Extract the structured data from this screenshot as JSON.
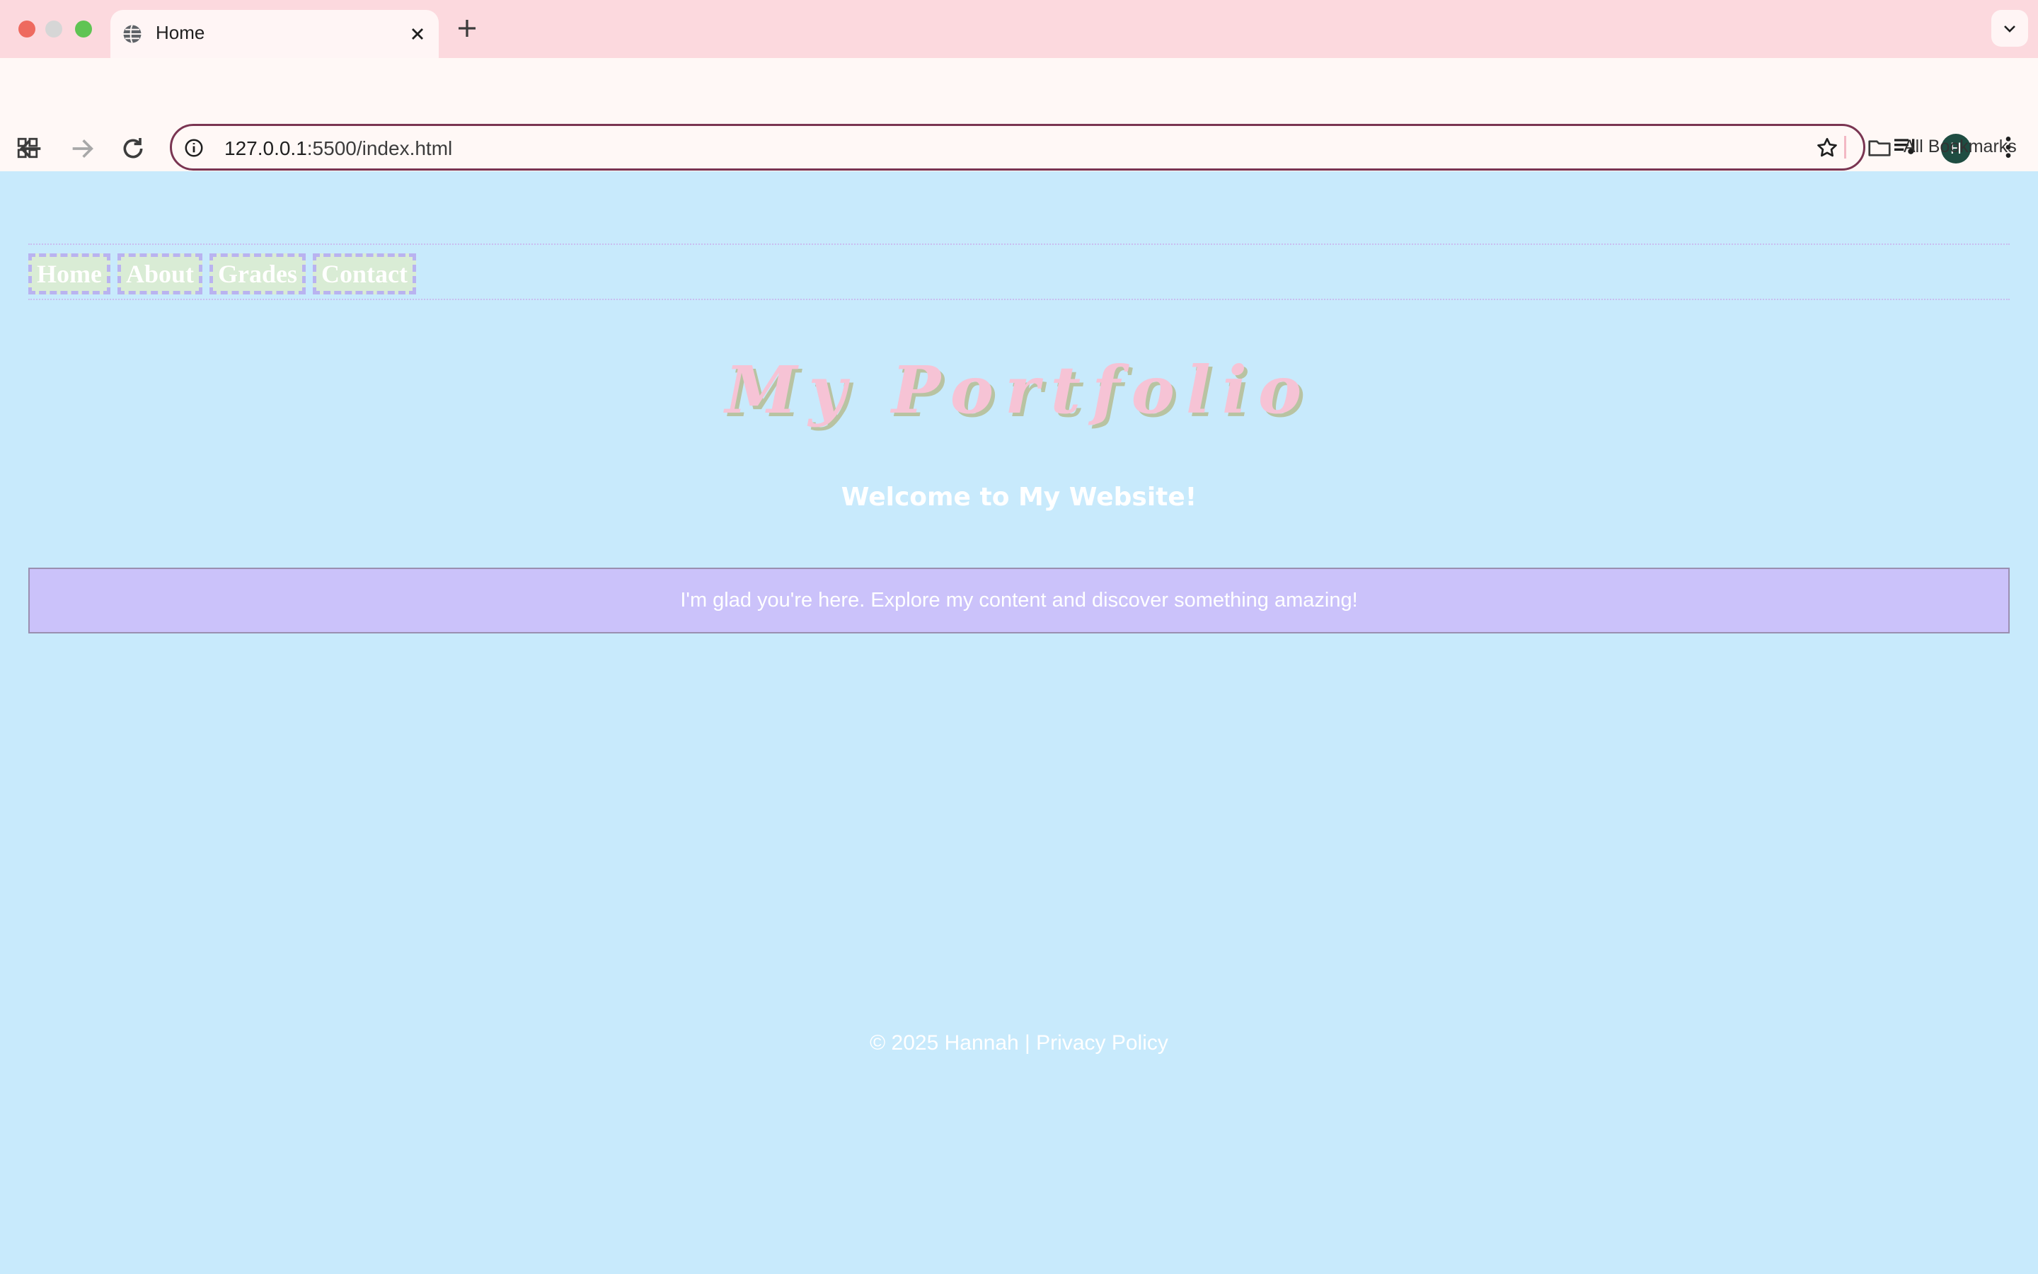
{
  "browser": {
    "tab": {
      "title": "Home"
    },
    "address_bar": {
      "url_host": "127.0.0.1",
      "url_rest": ":5500/index.html"
    },
    "profile_initial": "H",
    "bookmarks": {
      "all_bookmarks_label": "All Bookmarks"
    },
    "colors": {
      "tab_strip": "#fcd9de",
      "toolbar": "#fff8f6",
      "omnibox_border": "#7a3552"
    }
  },
  "page": {
    "nav": {
      "items": [
        "Home",
        "About",
        "Grades",
        "Contact"
      ]
    },
    "title": "My Portfolio",
    "welcome": "Welcome to My Website!",
    "message": "I'm glad you're here. Explore my content and discover something amazing!",
    "footer": {
      "copyright": "© 2025 Hannah | ",
      "privacy_link": "Privacy Policy"
    },
    "colors": {
      "background": "#c8eafc",
      "title_pink": "#f6c3d5",
      "message_box": "#cbc2fa",
      "nav_item_bg": "#d9ecd5",
      "nav_border": "#b9b3f0"
    }
  }
}
